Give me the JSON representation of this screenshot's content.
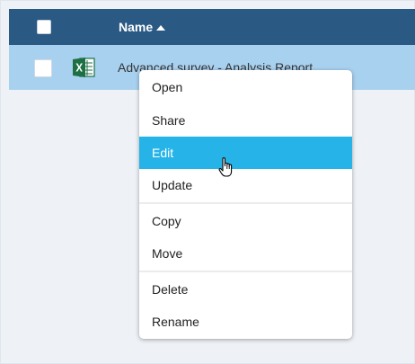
{
  "table": {
    "header": {
      "name_label": "Name",
      "sort_icon": "caret-up-icon"
    },
    "rows": [
      {
        "file_type_icon": "excel-file-icon",
        "file_name": "Advanced survey - Analysis Report",
        "selected": true
      }
    ]
  },
  "context_menu": {
    "items": [
      {
        "label": "Open"
      },
      {
        "label": "Share"
      },
      {
        "label": "Edit",
        "highlighted": true
      },
      {
        "label": "Update"
      },
      {
        "label": "Copy"
      },
      {
        "label": "Move"
      },
      {
        "label": "Delete"
      },
      {
        "label": "Rename"
      }
    ]
  },
  "colors": {
    "header_bg": "#2a5984",
    "selected_row_bg": "#a8d1f0",
    "menu_highlight": "#25b3e8",
    "excel_green": "#1d7044"
  },
  "cursor_icon": "hand-pointer-icon"
}
